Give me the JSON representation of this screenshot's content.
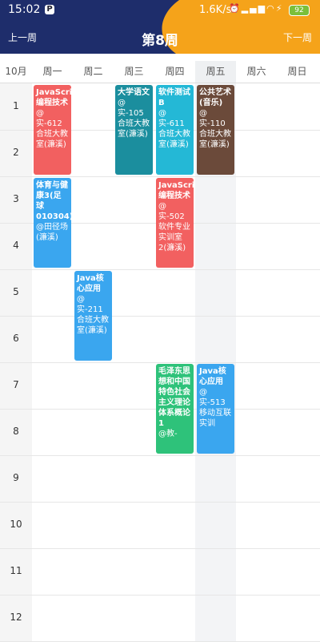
{
  "status": {
    "time": "15:02",
    "speed": "1.6K/s",
    "battery": "92",
    "app_badge": "P"
  },
  "nav": {
    "prev": "上一周",
    "title": "第8周",
    "next": "下一周"
  },
  "month": "10月",
  "days": [
    "周一",
    "周二",
    "周三",
    "周四",
    "周五",
    "周六",
    "周日"
  ],
  "today_index": 4,
  "rows": [
    "1",
    "2",
    "3",
    "4",
    "5",
    "6",
    "7",
    "8",
    "9",
    "10",
    "11",
    "12"
  ],
  "courses": [
    {
      "title": "JavaScript编程技术",
      "loc": "@实-612 合班大教室(濂溪)",
      "day": 0,
      "start": 1,
      "span": 2,
      "color": "#f26060"
    },
    {
      "title": "大学语文",
      "loc": "@实-105 合班大教室(濂溪)",
      "day": 2,
      "start": 1,
      "span": 2,
      "color": "#1b8e9e"
    },
    {
      "title": "软件测试B",
      "loc": "@实-611 合班大教室(濂溪)",
      "day": 3,
      "start": 1,
      "span": 2,
      "color": "#24b8d6"
    },
    {
      "title": "公共艺术(音乐)",
      "loc": "@实-110 合班大教室(濂溪)",
      "day": 4,
      "start": 1,
      "span": 2,
      "color": "#6b4a3a"
    },
    {
      "title": "体育与健康3(足球010304)",
      "loc": "@田径场(濂溪)",
      "day": 0,
      "start": 3,
      "span": 2,
      "color": "#3aa6ef"
    },
    {
      "title": "JavaScript编程技术",
      "loc": "@实-502 软件专业实训室2(濂溪)",
      "day": 3,
      "start": 3,
      "span": 2,
      "color": "#f26060"
    },
    {
      "title": "Java核心应用",
      "loc": "@实-211 合班大教室(濂溪)",
      "day": 1,
      "start": 5,
      "span": 2,
      "color": "#3aa6ef"
    },
    {
      "title": "毛泽东思想和中国特色社会主义理论体系概论1",
      "loc": "@教-",
      "day": 3,
      "start": 7,
      "span": 2,
      "color": "#2ec27a"
    },
    {
      "title": "Java核心应用",
      "loc": "@实-513 移动互联实训",
      "day": 4,
      "start": 7,
      "span": 2,
      "color": "#3aa6ef"
    }
  ]
}
